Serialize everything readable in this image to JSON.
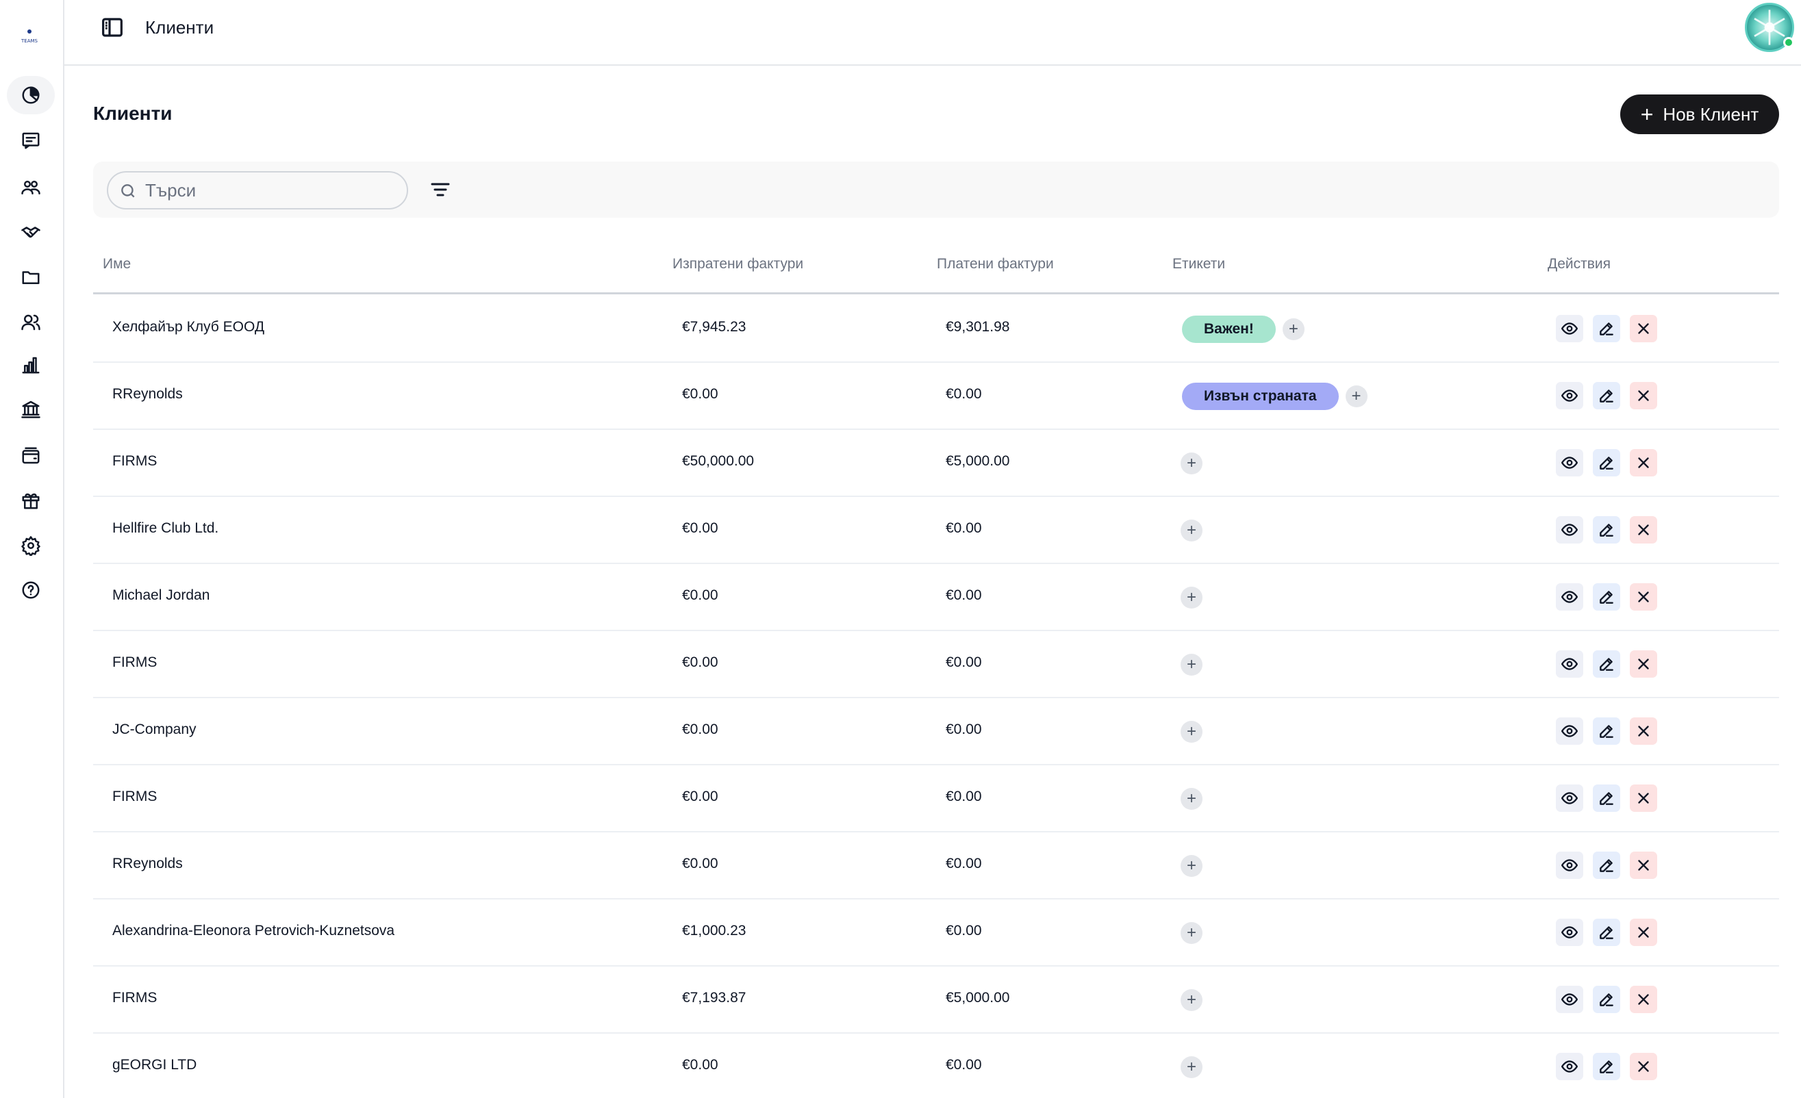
{
  "logo_text": "TEAMS",
  "topbar": {
    "title": "Клиенти"
  },
  "header": {
    "title": "Клиенти",
    "new_button": "Нов Клиент"
  },
  "search": {
    "placeholder": "Търси",
    "value": ""
  },
  "columns": [
    "Име",
    "Изпратени фактури",
    "Платени фактури",
    "Етикети",
    "Действия"
  ],
  "rows": [
    {
      "name": "Хелфайър Клуб ЕООД",
      "sent": "€7,945.23",
      "paid": "€9,301.98",
      "tag": "Важен!",
      "tag_color": "#a7e5cf"
    },
    {
      "name": "RReynolds",
      "sent": "€0.00",
      "paid": "€0.00",
      "tag": "Извън страната",
      "tag_color": "#a3aaf6"
    },
    {
      "name": "FIRMS",
      "sent": "€50,000.00",
      "paid": "€5,000.00",
      "tag": null
    },
    {
      "name": "Hellfire Club Ltd.",
      "sent": "€0.00",
      "paid": "€0.00",
      "tag": null
    },
    {
      "name": "Michael Jordan",
      "sent": "€0.00",
      "paid": "€0.00",
      "tag": null
    },
    {
      "name": "FIRMS",
      "sent": "€0.00",
      "paid": "€0.00",
      "tag": null
    },
    {
      "name": "JC-Company",
      "sent": "€0.00",
      "paid": "€0.00",
      "tag": null
    },
    {
      "name": "FIRMS",
      "sent": "€0.00",
      "paid": "€0.00",
      "tag": null
    },
    {
      "name": "RReynolds",
      "sent": "€0.00",
      "paid": "€0.00",
      "tag": null
    },
    {
      "name": "Alexandrina-Eleonora Petrovich-Kuznetsova",
      "sent": "€1,000.23",
      "paid": "€0.00",
      "tag": null
    },
    {
      "name": "FIRMS",
      "sent": "€7,193.87",
      "paid": "€5,000.00",
      "tag": null
    },
    {
      "name": "gEORGI LTD",
      "sent": "€0.00",
      "paid": "€0.00",
      "tag": null
    }
  ],
  "sidebar": [
    {
      "name": "dashboard-icon",
      "active": true
    },
    {
      "name": "invoices-icon"
    },
    {
      "name": "clients-icon"
    },
    {
      "name": "partners-icon"
    },
    {
      "name": "folder-icon"
    },
    {
      "name": "team-icon"
    },
    {
      "name": "reports-icon"
    },
    {
      "name": "bank-icon"
    },
    {
      "name": "wallet-icon"
    },
    {
      "name": "gift-icon"
    },
    {
      "name": "settings-icon"
    },
    {
      "name": "help-icon"
    }
  ]
}
